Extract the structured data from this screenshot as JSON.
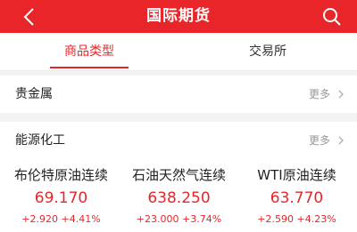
{
  "header": {
    "title": "国际期货"
  },
  "tabs": [
    {
      "label": "商品类型"
    },
    {
      "label": "交易所"
    }
  ],
  "sections": [
    {
      "label": "贵金属",
      "more": "更多"
    },
    {
      "label": "能源化工",
      "more": "更多"
    }
  ],
  "quotes": [
    {
      "name": "布伦特原油连续",
      "price": "69.170",
      "change": "+2.920",
      "percent": "+4.41%"
    },
    {
      "name": "石油天然气连续",
      "price": "638.250",
      "change": "+23.000",
      "percent": "+3.74%"
    },
    {
      "name": "WTI原油连续",
      "price": "63.770",
      "change": "+2.590",
      "percent": "+4.23%"
    }
  ],
  "colors": {
    "accent": "#e8262a",
    "background": "#f3f3f3"
  }
}
